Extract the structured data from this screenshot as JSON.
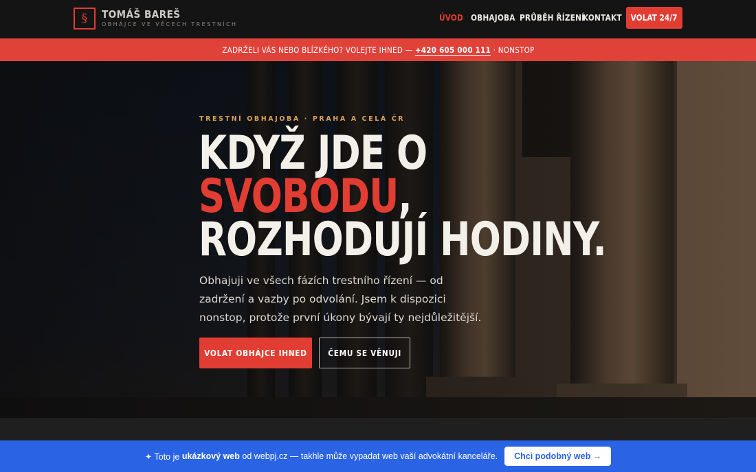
{
  "brand": {
    "logo_symbol": "§",
    "name": "TOMÁŠ BAREŠ",
    "tagline": "OBHÁJCE VE VĚCECH TRESTNÍCH"
  },
  "nav": {
    "items": [
      {
        "label": "ÚVOD",
        "active": true
      },
      {
        "label": "OBHAJOBA",
        "active": false
      },
      {
        "label": "PRŮBĚH ŘÍZENÍ",
        "active": false
      },
      {
        "label": "KONTAKT",
        "active": false
      }
    ],
    "cta_label": "VOLAT 24/7"
  },
  "alert": {
    "text": "ZADRŽELI VÁS NEBO BLÍZKÉHO? VOLEJTE IHNED —",
    "phone": "+420 605 000 111",
    "suffix": "· NONSTOP"
  },
  "hero": {
    "eyebrow": "TRESTNÍ OBHAJOBA · PRAHA A CELÁ ČR",
    "headline_line1": "KDYŽ JDE O",
    "headline_highlight": "SVOBODU",
    "headline_comma": ",",
    "headline_line3": "ROZHODUJÍ HODINY.",
    "lead": "Obhajuji ve všech fázích trestního řízení — od zadržení a vazby po odvolání. Jsem k dispozici nonstop, protože první úkony bývají ty nejdůležitější.",
    "primary_button": "VOLAT OBHÁJCE IHNED",
    "secondary_button": "ČEMU SE VĚNUJI"
  },
  "demo_banner": {
    "prefix": "✦ Toto je",
    "bold": "ukázkový web",
    "suffix": "od webpj.cz — takhle může vypadat web vaší advokátní kanceláře.",
    "button": "Chci podobný web →"
  },
  "colors": {
    "accent": "#e23d32",
    "alert_bar": "#e0423a",
    "header_bg": "#141414",
    "eyebrow": "#d9a15c",
    "demo_banner": "#2a63e4"
  }
}
